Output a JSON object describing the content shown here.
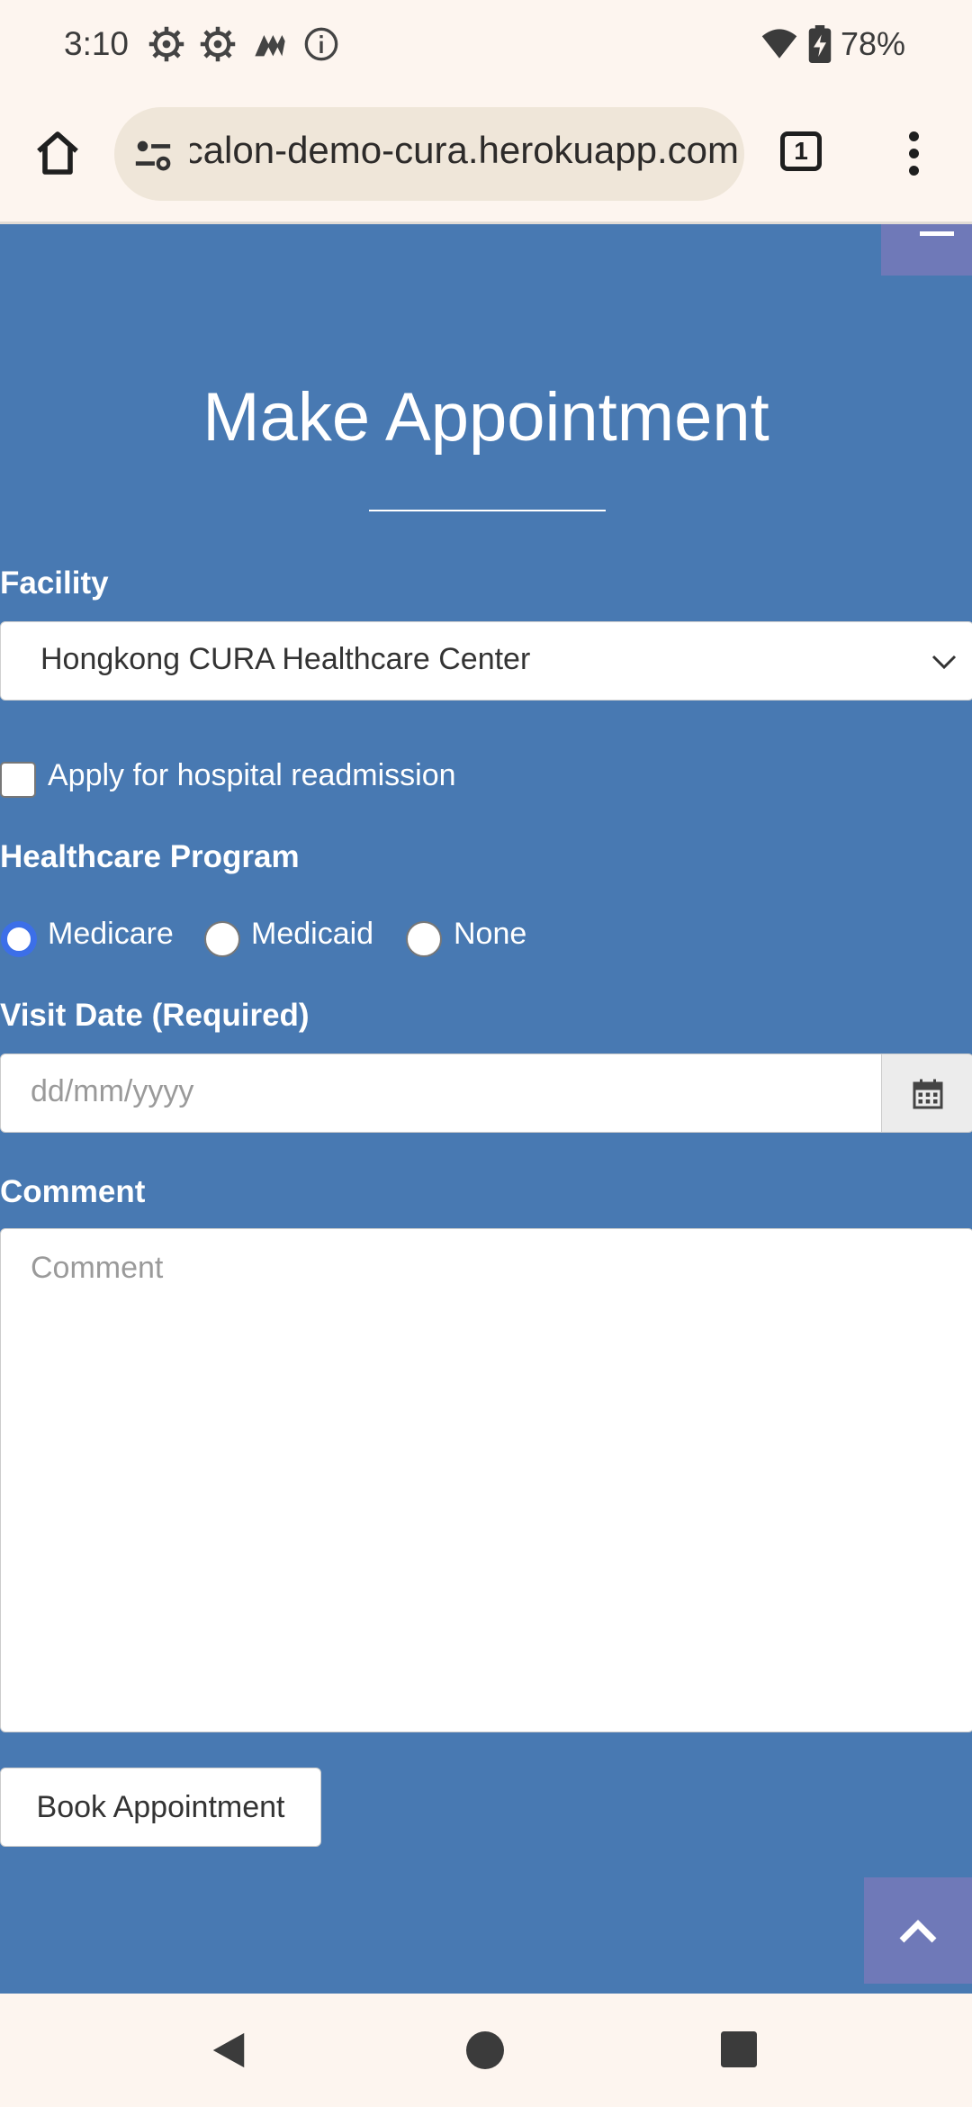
{
  "status_bar": {
    "time": "3:10",
    "battery": "78%",
    "icons": [
      "settings-icon",
      "settings-icon",
      "app-icon",
      "info-icon",
      "wifi-icon",
      "battery-charging-icon"
    ]
  },
  "browser": {
    "url": "calon-demo-cura.herokuapp.com",
    "tab_count": "1"
  },
  "page": {
    "title": "Make Appointment",
    "facility": {
      "label": "Facility",
      "selected": "Hongkong CURA Healthcare Center"
    },
    "readmission": {
      "label": "Apply for hospital readmission",
      "checked": false
    },
    "program": {
      "label": "Healthcare Program",
      "options": [
        "Medicare",
        "Medicaid",
        "None"
      ],
      "selected": "Medicare"
    },
    "visit_date": {
      "label": "Visit Date (Required)",
      "placeholder": "dd/mm/yyyy"
    },
    "comment": {
      "label": "Comment",
      "placeholder": "Comment"
    },
    "book_button": "Book Appointment"
  },
  "colors": {
    "page_bg": "#4879b2",
    "accent": "#6f79b8",
    "radio_checked": "#3c6fe8"
  }
}
